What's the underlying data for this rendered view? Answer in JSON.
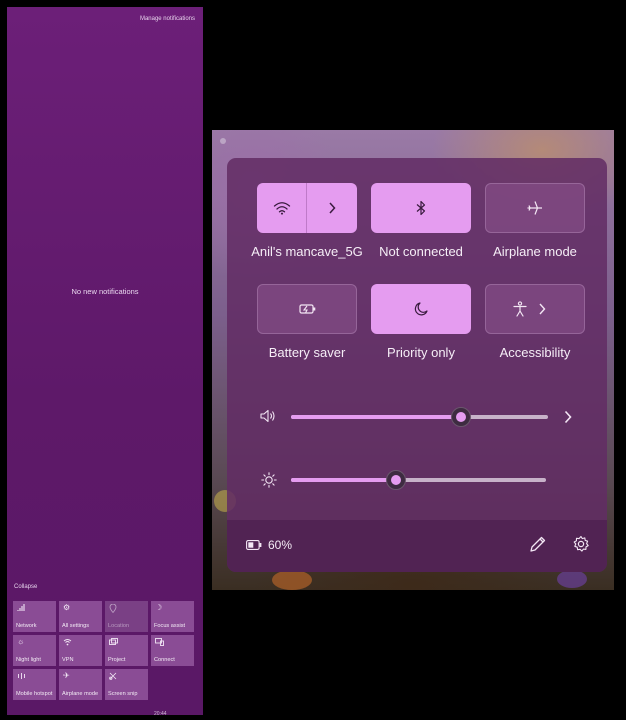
{
  "action_center": {
    "manage_label": "Manage notifications",
    "empty_label": "No new notifications",
    "collapse_label": "Collapse",
    "bottom_text": "20:44",
    "tiles": [
      {
        "label": "Network",
        "icon": "network-icon",
        "dim": false
      },
      {
        "label": "All settings",
        "icon": "gear-icon",
        "dim": false
      },
      {
        "label": "Location",
        "icon": "location-icon",
        "dim": true
      },
      {
        "label": "Focus assist",
        "icon": "moon-icon",
        "dim": false
      },
      {
        "label": "Night light",
        "icon": "brightness-icon",
        "dim": false
      },
      {
        "label": "VPN",
        "icon": "vpn-icon",
        "dim": false
      },
      {
        "label": "Project",
        "icon": "project-icon",
        "dim": false
      },
      {
        "label": "Connect",
        "icon": "connect-icon",
        "dim": false
      },
      {
        "label": "Mobile hotspot",
        "icon": "hotspot-icon",
        "dim": false
      },
      {
        "label": "Airplane mode",
        "icon": "airplane-icon",
        "dim": false
      },
      {
        "label": "Screen snip",
        "icon": "snip-icon",
        "dim": false
      }
    ]
  },
  "quick_settings": {
    "wifi_label": "Anil's mancave_5G",
    "bluetooth_label": "Not connected",
    "airplane_label": "Airplane mode",
    "battery_saver_label": "Battery saver",
    "priority_label": "Priority only",
    "accessibility_label": "Accessibility",
    "volume_level": 0.66,
    "brightness_level": 0.41,
    "battery_text": "60%",
    "colors": {
      "accent": "#e59cf0",
      "panel": "#622c64"
    }
  }
}
